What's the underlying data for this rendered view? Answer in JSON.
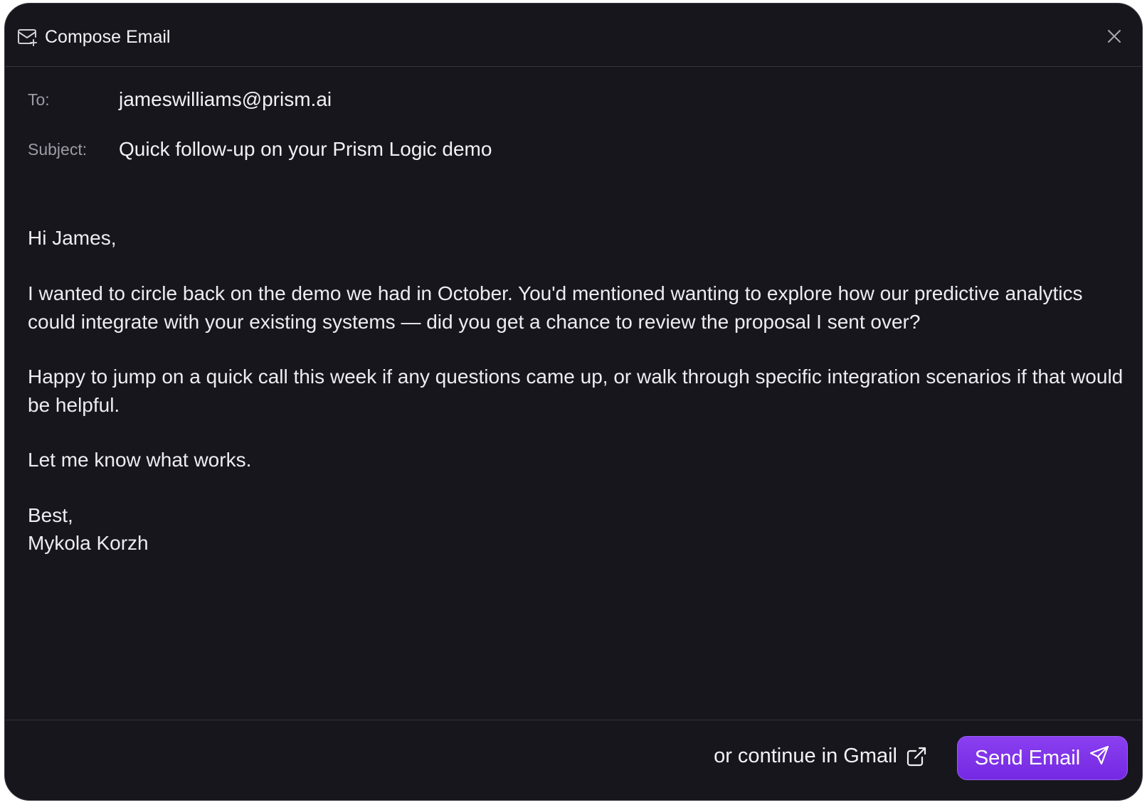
{
  "header": {
    "title": "Compose Email",
    "icon": "mail-plus-icon",
    "close_icon": "close-icon"
  },
  "fields": {
    "to_label": "To:",
    "to_value": "jameswilliams@prism.ai",
    "subject_label": "Subject:",
    "subject_value": "Quick follow-up on your Prism Logic demo"
  },
  "body": {
    "greeting": "Hi James,",
    "paragraph1": "I wanted to circle back on the demo we had in October. You'd mentioned wanting to explore how our predictive analytics could integrate with your existing systems — did you get a chance to review the proposal I sent over?",
    "paragraph2": "Happy to jump on a quick call this week if any questions came up, or walk through specific integration scenarios if that would be helpful.",
    "paragraph3": "Let me know what works.",
    "signoff": "Best,",
    "signature": "Mykola Korzh"
  },
  "footer": {
    "gmail_label": "or continue in Gmail",
    "gmail_icon": "external-link-icon",
    "send_label": "Send Email",
    "send_icon": "send-icon"
  },
  "colors": {
    "background": "#18161d",
    "accent": "#7c3aed",
    "text": "#f2f2f5",
    "muted": "#9d9ba4"
  }
}
